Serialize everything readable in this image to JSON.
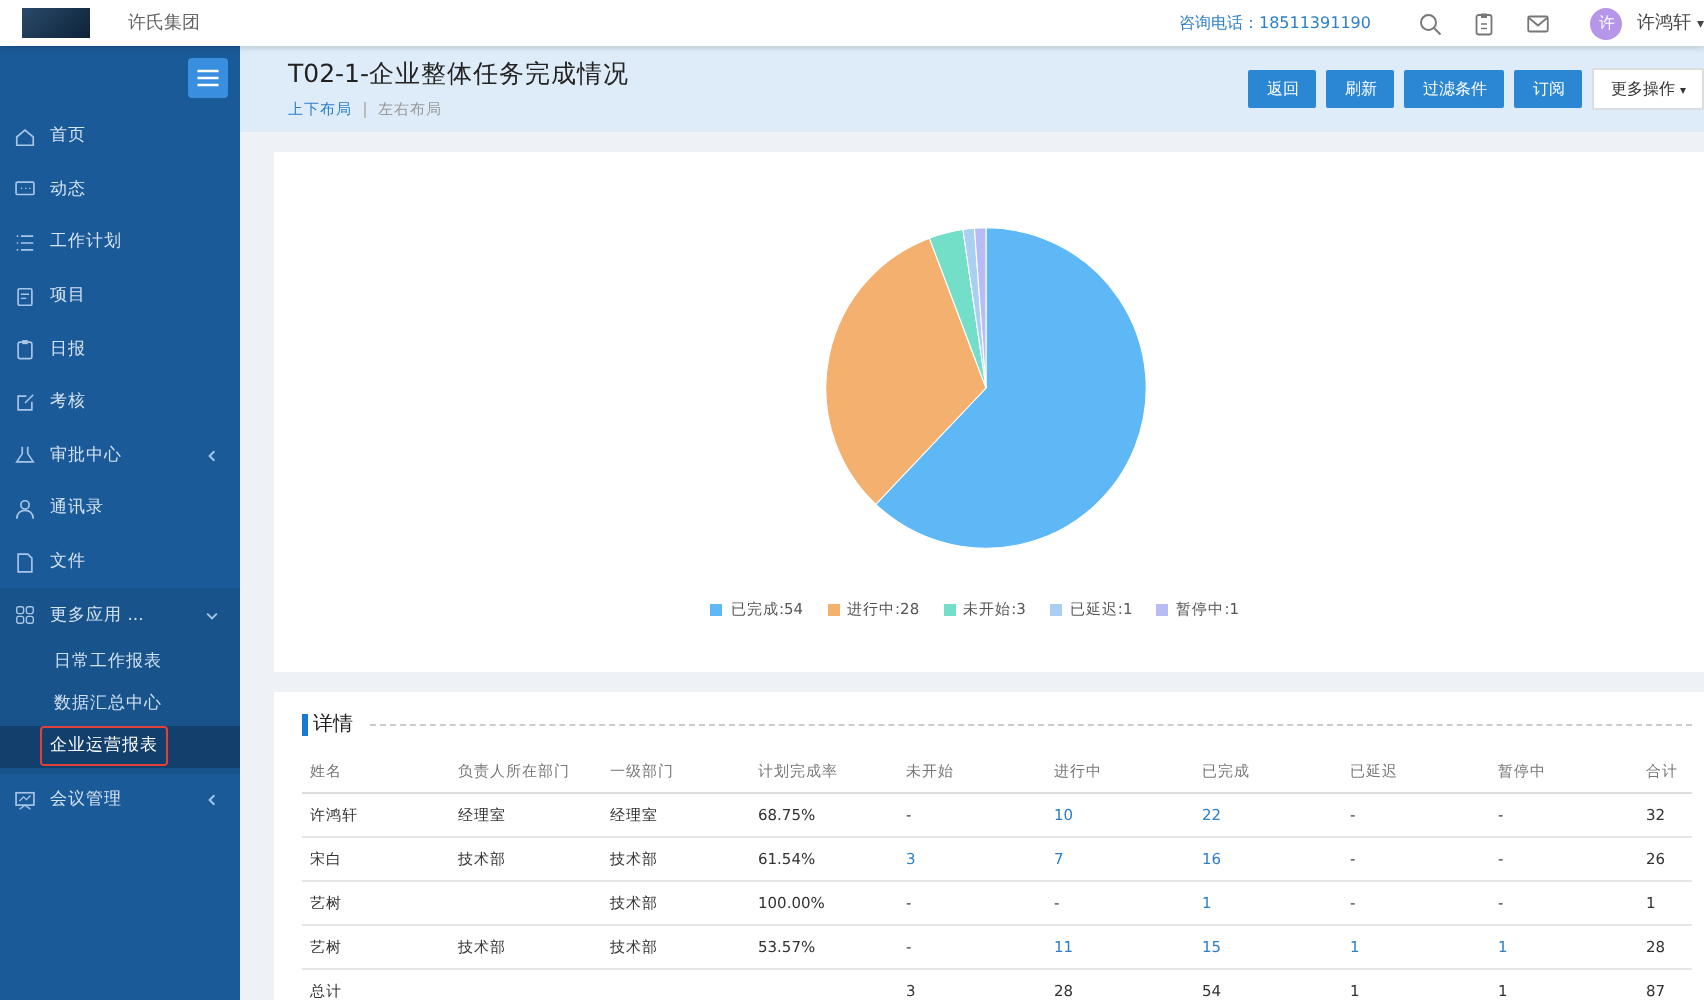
{
  "header": {
    "company": "许氏集团",
    "hotline": "咨询电话：18511391190",
    "avatar": "许",
    "user": "许鸿轩",
    "user_caret": "▾"
  },
  "sidebar": {
    "items": [
      {
        "label": "首页"
      },
      {
        "label": "动态"
      },
      {
        "label": "工作计划"
      },
      {
        "label": "项目"
      },
      {
        "label": "日报"
      },
      {
        "label": "考核"
      },
      {
        "label": "审批中心",
        "expanded": false
      },
      {
        "label": "通讯录"
      },
      {
        "label": "文件"
      },
      {
        "label": "更多应用 ...",
        "expanded": true,
        "children": [
          {
            "label": "日常工作报表",
            "selected": false
          },
          {
            "label": "数据汇总中心",
            "selected": false
          },
          {
            "label": "企业运营报表",
            "selected": true
          }
        ]
      },
      {
        "label": "会议管理",
        "expanded": false
      }
    ]
  },
  "page": {
    "title": "T02-1-企业整体任务完成情况",
    "layouts": [
      {
        "label": "上下布局",
        "selected": true
      },
      {
        "label": "左右布局",
        "selected": false
      }
    ],
    "buttons": [
      {
        "label": "返回",
        "kind": "primary"
      },
      {
        "label": "刷新",
        "kind": "primary"
      },
      {
        "label": "过滤条件",
        "kind": "primary"
      },
      {
        "label": "订阅",
        "kind": "primary"
      },
      {
        "label": "更多操作",
        "kind": "dropdown",
        "caret": "▾"
      }
    ]
  },
  "chart": {
    "chart_data": {
      "type": "pie",
      "categories": [
        "已完成:54",
        "进行中:28",
        "未开始:3",
        "已延迟:1",
        "暂停中:1"
      ],
      "values": [
        54,
        28,
        3,
        1,
        1
      ]
    },
    "legend": [
      {
        "color": "#5fb8f6"
      },
      {
        "color": "#f4b06e"
      },
      {
        "color": "#74dfc9"
      },
      {
        "color": "#a9cff3"
      },
      {
        "color": "#b9bcf4"
      }
    ]
  },
  "details": {
    "title": "详情",
    "columns": [
      "姓名",
      "负责人所在部门",
      "一级部门",
      "计划完成率",
      "未开始",
      "进行中",
      "已完成",
      "已延迟",
      "暂停中",
      "合计"
    ],
    "rows": [
      {
        "cells": [
          {
            "text": "许鸿轩",
            "link": false
          },
          {
            "text": "经理室",
            "link": false
          },
          {
            "text": "经理室",
            "link": false
          },
          {
            "text": "68.75%",
            "link": false
          },
          {
            "text": "-",
            "link": false
          },
          {
            "text": "10",
            "link": true
          },
          {
            "text": "22",
            "link": true
          },
          {
            "text": "-",
            "link": false
          },
          {
            "text": "-",
            "link": false
          },
          {
            "text": "32",
            "link": false
          }
        ]
      },
      {
        "cells": [
          {
            "text": "宋白",
            "link": false
          },
          {
            "text": "技术部",
            "link": false
          },
          {
            "text": "技术部",
            "link": false
          },
          {
            "text": "61.54%",
            "link": false
          },
          {
            "text": "3",
            "link": true
          },
          {
            "text": "7",
            "link": true
          },
          {
            "text": "16",
            "link": true
          },
          {
            "text": "-",
            "link": false
          },
          {
            "text": "-",
            "link": false
          },
          {
            "text": "26",
            "link": false
          }
        ]
      },
      {
        "cells": [
          {
            "text": "艺树",
            "link": false
          },
          null,
          {
            "text": "技术部",
            "link": false
          },
          {
            "text": "100.00%",
            "link": false
          },
          {
            "text": "-",
            "link": false
          },
          {
            "text": "-",
            "link": false
          },
          {
            "text": "1",
            "link": true
          },
          {
            "text": "-",
            "link": false
          },
          {
            "text": "-",
            "link": false
          },
          {
            "text": "1",
            "link": false
          }
        ]
      },
      {
        "cells": [
          {
            "text": "艺树",
            "link": false
          },
          {
            "text": "技术部",
            "link": false
          },
          {
            "text": "技术部",
            "link": false
          },
          {
            "text": "53.57%",
            "link": false
          },
          {
            "text": "-",
            "link": false
          },
          {
            "text": "11",
            "link": true
          },
          {
            "text": "15",
            "link": true
          },
          {
            "text": "1",
            "link": true
          },
          {
            "text": "1",
            "link": true
          },
          {
            "text": "28",
            "link": false
          }
        ]
      },
      {
        "cells": [
          {
            "text": "总计",
            "link": false
          },
          null,
          null,
          null,
          {
            "text": "3",
            "link": false
          },
          {
            "text": "28",
            "link": false
          },
          {
            "text": "54",
            "link": false
          },
          {
            "text": "1",
            "link": false
          },
          {
            "text": "1",
            "link": false
          },
          {
            "text": "87",
            "link": false
          }
        ]
      }
    ]
  }
}
